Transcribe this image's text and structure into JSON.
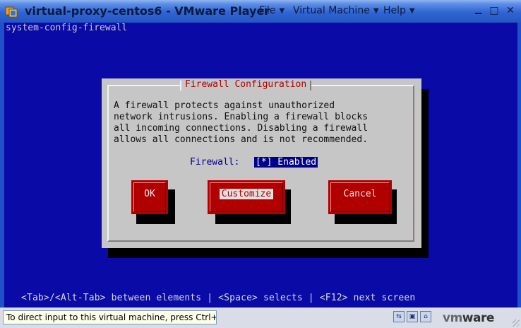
{
  "window": {
    "title": "virtual-proxy-centos6 - VMware Player",
    "menu": [
      "File",
      "Virtual Machine",
      "Help"
    ],
    "menu_arrow": "▼"
  },
  "console": {
    "title": "system-config-firewall",
    "dialog": {
      "title": "Firewall Configuration",
      "lines": [
        "A firewall protects against unauthorized",
        "network intrusions. Enabling a firewall blocks",
        "all incoming connections. Disabling a firewall",
        "allows all connections and is not recommended."
      ],
      "firewall_label": "Firewall:",
      "firewall_value": "[*] Enabled",
      "buttons": {
        "ok": "OK",
        "customize": "Customize",
        "cancel": "Cancel"
      }
    },
    "help_line": "<Tab>/<Alt-Tab> between elements   |  <Space> selects   |  <F12> next screen"
  },
  "statusbar": {
    "text": "To direct input to this virtual machine, press Ctrl+G.",
    "logo_vm": "vm",
    "logo_ware": "ware"
  }
}
